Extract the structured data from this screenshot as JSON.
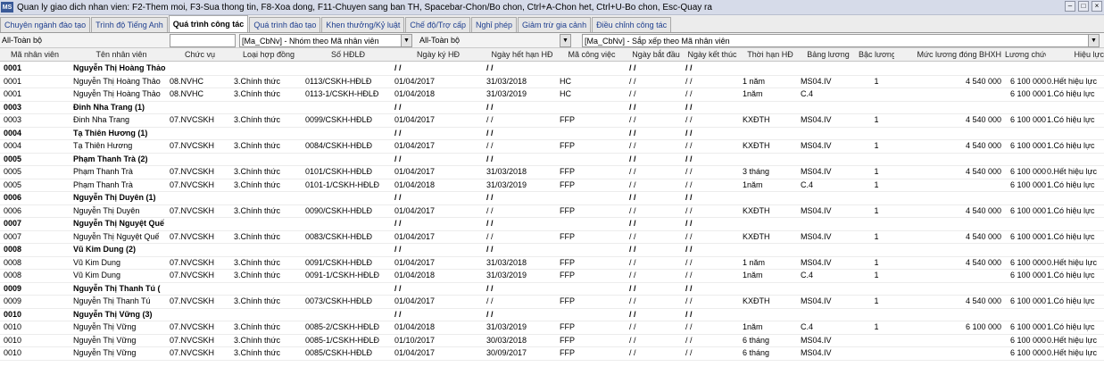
{
  "window": {
    "title": "Quan ly giao dich nhan vien: F2-Them moi, F3-Sua thong tin, F8-Xoa dong, F11-Chuyen sang ban TH, Spacebar-Chon/Bo chon, Ctrl+A-Chon het, Ctrl+U-Bo chon, Esc-Quay ra",
    "icon_text": "MS"
  },
  "tabs": [
    {
      "label": "Chuyên ngành đào tạo",
      "active": false
    },
    {
      "label": "Trình độ Tiếng Anh",
      "active": false
    },
    {
      "label": "Quá trình công tác",
      "active": true
    },
    {
      "label": "Quá trình đào tạo",
      "active": false
    },
    {
      "label": "Khen thưởng/Kỷ luật",
      "active": false
    },
    {
      "label": "Chế độ/Trợ cấp",
      "active": false
    },
    {
      "label": "Nghỉ phép",
      "active": false
    },
    {
      "label": "Giảm trừ gia cảnh",
      "active": false
    },
    {
      "label": "Điều chỉnh công tác",
      "active": false
    }
  ],
  "filters": {
    "filter1": "All-Toàn bộ",
    "group_by": "[Ma_CbNv] - Nhóm theo Mã nhân viên",
    "filter2": "All-Toàn bộ",
    "sort_by": "[Ma_CbNv] - Sắp xếp theo Mã nhân viên"
  },
  "columns": [
    "Mã nhân viên",
    "Tên nhân viên",
    "Chức vụ",
    "Loại hợp đồng",
    "Số HĐLĐ",
    "Ngày ký HĐ",
    "Ngày hết hạn HĐ",
    "Mã công việc",
    "Ngày bắt đầu",
    "Ngày kết thúc",
    "Thời hạn HĐ",
    "Bảng lương",
    "Bậc lương",
    "Mức lương đóng BHXH",
    "Lương chức danh",
    "Hiệu lực"
  ],
  "rows": [
    {
      "group": true,
      "cells": [
        "0001",
        "Nguyễn Thị Hoàng Thảo",
        "",
        "",
        "",
        "/ /",
        "/ /",
        "",
        "/ /",
        "/ /",
        "",
        "",
        "",
        "",
        "",
        ""
      ]
    },
    {
      "group": false,
      "cells": [
        "0001",
        "Nguyễn Thị Hoàng Thảo",
        "08.NVHC",
        "3.Chính thức",
        "0113/CSKH-HĐLĐ",
        "01/04/2017",
        "31/03/2018",
        "HC",
        "/ /",
        "/ /",
        "1 năm",
        "MS04.IV",
        "1",
        "4 540 000",
        "6 100 000",
        "0.Hết hiệu lực"
      ]
    },
    {
      "group": false,
      "cells": [
        "0001",
        "Nguyễn Thị Hoàng Thảo",
        "08.NVHC",
        "3.Chính thức",
        "0113-1/CSKH-HĐLĐ",
        "01/04/2018",
        "31/03/2019",
        "HC",
        "/ /",
        "/ /",
        "1năm",
        "C.4",
        "",
        "",
        "6 100 000",
        "1.Có hiệu lực"
      ]
    },
    {
      "group": true,
      "cells": [
        "0003",
        "Đinh Nha Trang (1)",
        "",
        "",
        "",
        "/ /",
        "/ /",
        "",
        "/ /",
        "/ /",
        "",
        "",
        "",
        "",
        "",
        ""
      ]
    },
    {
      "group": false,
      "cells": [
        "0003",
        "Đinh Nha Trang",
        "07.NVCSKH",
        "3.Chính thức",
        "0099/CSKH-HĐLĐ",
        "01/04/2017",
        "/ /",
        "FFP",
        "/ /",
        "/ /",
        "KXĐTH",
        "MS04.IV",
        "1",
        "4 540 000",
        "6 100 000",
        "1.Có hiệu lực"
      ]
    },
    {
      "group": true,
      "cells": [
        "0004",
        "Tạ Thiên Hương (1)",
        "",
        "",
        "",
        "/ /",
        "/ /",
        "",
        "/ /",
        "/ /",
        "",
        "",
        "",
        "",
        "",
        ""
      ]
    },
    {
      "group": false,
      "cells": [
        "0004",
        "Tạ Thiên Hương",
        "07.NVCSKH",
        "3.Chính thức",
        "0084/CSKH-HĐLĐ",
        "01/04/2017",
        "/ /",
        "FFP",
        "/ /",
        "/ /",
        "KXĐTH",
        "MS04.IV",
        "1",
        "4 540 000",
        "6 100 000",
        "1.Có hiệu lực"
      ]
    },
    {
      "group": true,
      "cells": [
        "0005",
        "Phạm Thanh Trà (2)",
        "",
        "",
        "",
        "/ /",
        "/ /",
        "",
        "/ /",
        "/ /",
        "",
        "",
        "",
        "",
        "",
        ""
      ]
    },
    {
      "group": false,
      "cells": [
        "0005",
        "Phạm Thanh Trà",
        "07.NVCSKH",
        "3.Chính thức",
        "0101/CSKH-HĐLĐ",
        "01/04/2017",
        "31/03/2018",
        "FFP",
        "/ /",
        "/ /",
        "3 tháng",
        "MS04.IV",
        "1",
        "4 540 000",
        "6 100 000",
        "0.Hết hiệu lực"
      ]
    },
    {
      "group": false,
      "cells": [
        "0005",
        "Phạm Thanh Trà",
        "07.NVCSKH",
        "3.Chính thức",
        "0101-1/CSKH-HĐLĐ",
        "01/04/2018",
        "31/03/2019",
        "FFP",
        "/ /",
        "/ /",
        "1năm",
        "C.4",
        "1",
        "",
        "6 100 000",
        "1.Có hiệu lực"
      ]
    },
    {
      "group": true,
      "cells": [
        "0006",
        "Nguyễn Thị Duyên (1)",
        "",
        "",
        "",
        "/ /",
        "/ /",
        "",
        "/ /",
        "/ /",
        "",
        "",
        "",
        "",
        "",
        ""
      ]
    },
    {
      "group": false,
      "cells": [
        "0006",
        "Nguyễn Thị Duyên",
        "07.NVCSKH",
        "3.Chính thức",
        "0090/CSKH-HĐLĐ",
        "01/04/2017",
        "/ /",
        "FFP",
        "/ /",
        "/ /",
        "KXĐTH",
        "MS04.IV",
        "1",
        "4 540 000",
        "6 100 000",
        "1.Có hiệu lực"
      ]
    },
    {
      "group": true,
      "cells": [
        "0007",
        "Nguyễn Thị Nguyệt Quế",
        "",
        "",
        "",
        "/ /",
        "/ /",
        "",
        "/ /",
        "/ /",
        "",
        "",
        "",
        "",
        "",
        ""
      ]
    },
    {
      "group": false,
      "cells": [
        "0007",
        "Nguyễn Thị Nguyệt Quế",
        "07.NVCSKH",
        "3.Chính thức",
        "0083/CSKH-HĐLĐ",
        "01/04/2017",
        "/ /",
        "FFP",
        "/ /",
        "/ /",
        "KXĐTH",
        "MS04.IV",
        "1",
        "4 540 000",
        "6 100 000",
        "1.Có hiệu lực"
      ]
    },
    {
      "group": true,
      "cells": [
        "0008",
        "Vũ Kim Dung (2)",
        "",
        "",
        "",
        "/ /",
        "/ /",
        "",
        "/ /",
        "/ /",
        "",
        "",
        "",
        "",
        "",
        ""
      ]
    },
    {
      "group": false,
      "cells": [
        "0008",
        "Vũ Kim Dung",
        "07.NVCSKH",
        "3.Chính thức",
        "0091/CSKH-HĐLĐ",
        "01/04/2017",
        "31/03/2018",
        "FFP",
        "/ /",
        "/ /",
        "1 năm",
        "MS04.IV",
        "1",
        "4 540 000",
        "6 100 000",
        "0.Hết hiệu lực"
      ]
    },
    {
      "group": false,
      "cells": [
        "0008",
        "Vũ Kim Dung",
        "07.NVCSKH",
        "3.Chính thức",
        "0091-1/CSKH-HĐLĐ",
        "01/04/2018",
        "31/03/2019",
        "FFP",
        "/ /",
        "/ /",
        "1năm",
        "C.4",
        "1",
        "",
        "6 100 000",
        "1.Có hiệu lực"
      ]
    },
    {
      "group": true,
      "cells": [
        "0009",
        "Nguyễn Thị Thanh Tú (",
        "",
        "",
        "",
        "/ /",
        "/ /",
        "",
        "/ /",
        "/ /",
        "",
        "",
        "",
        "",
        "",
        ""
      ]
    },
    {
      "group": false,
      "cells": [
        "0009",
        "Nguyễn Thị Thanh Tú",
        "07.NVCSKH",
        "3.Chính thức",
        "0073/CSKH-HĐLĐ",
        "01/04/2017",
        "/ /",
        "FFP",
        "/ /",
        "/ /",
        "KXĐTH",
        "MS04.IV",
        "1",
        "4 540 000",
        "6 100 000",
        "1.Có hiệu lực"
      ]
    },
    {
      "group": true,
      "cells": [
        "0010",
        "Nguyễn Thị Vững (3)",
        "",
        "",
        "",
        "/ /",
        "/ /",
        "",
        "/ /",
        "/ /",
        "",
        "",
        "",
        "",
        "",
        ""
      ]
    },
    {
      "group": false,
      "cells": [
        "0010",
        "Nguyễn Thị Vững",
        "07.NVCSKH",
        "3.Chính thức",
        "0085-2/CSKH-HĐLĐ",
        "01/04/2018",
        "31/03/2019",
        "FFP",
        "/ /",
        "/ /",
        "1năm",
        "C.4",
        "1",
        "6 100 000",
        "6 100 000",
        "1.Có hiệu lực"
      ]
    },
    {
      "group": false,
      "cells": [
        "0010",
        "Nguyễn Thị Vững",
        "07.NVCSKH",
        "3.Chính thức",
        "0085-1/CSKH-HĐLĐ",
        "01/10/2017",
        "30/03/2018",
        "FFP",
        "/ /",
        "/ /",
        "6 tháng",
        "MS04.IV",
        "",
        "",
        "6 100 000",
        "0.Hết hiệu lực"
      ]
    },
    {
      "group": false,
      "cells": [
        "0010",
        "Nguyễn Thị Vững",
        "07.NVCSKH",
        "3.Chính thức",
        "0085/CSKH-HĐLĐ",
        "01/04/2017",
        "30/09/2017",
        "FFP",
        "/ /",
        "/ /",
        "6 tháng",
        "MS04.IV",
        "",
        "",
        "6 100 000",
        "0.Hết hiệu lực"
      ]
    }
  ]
}
